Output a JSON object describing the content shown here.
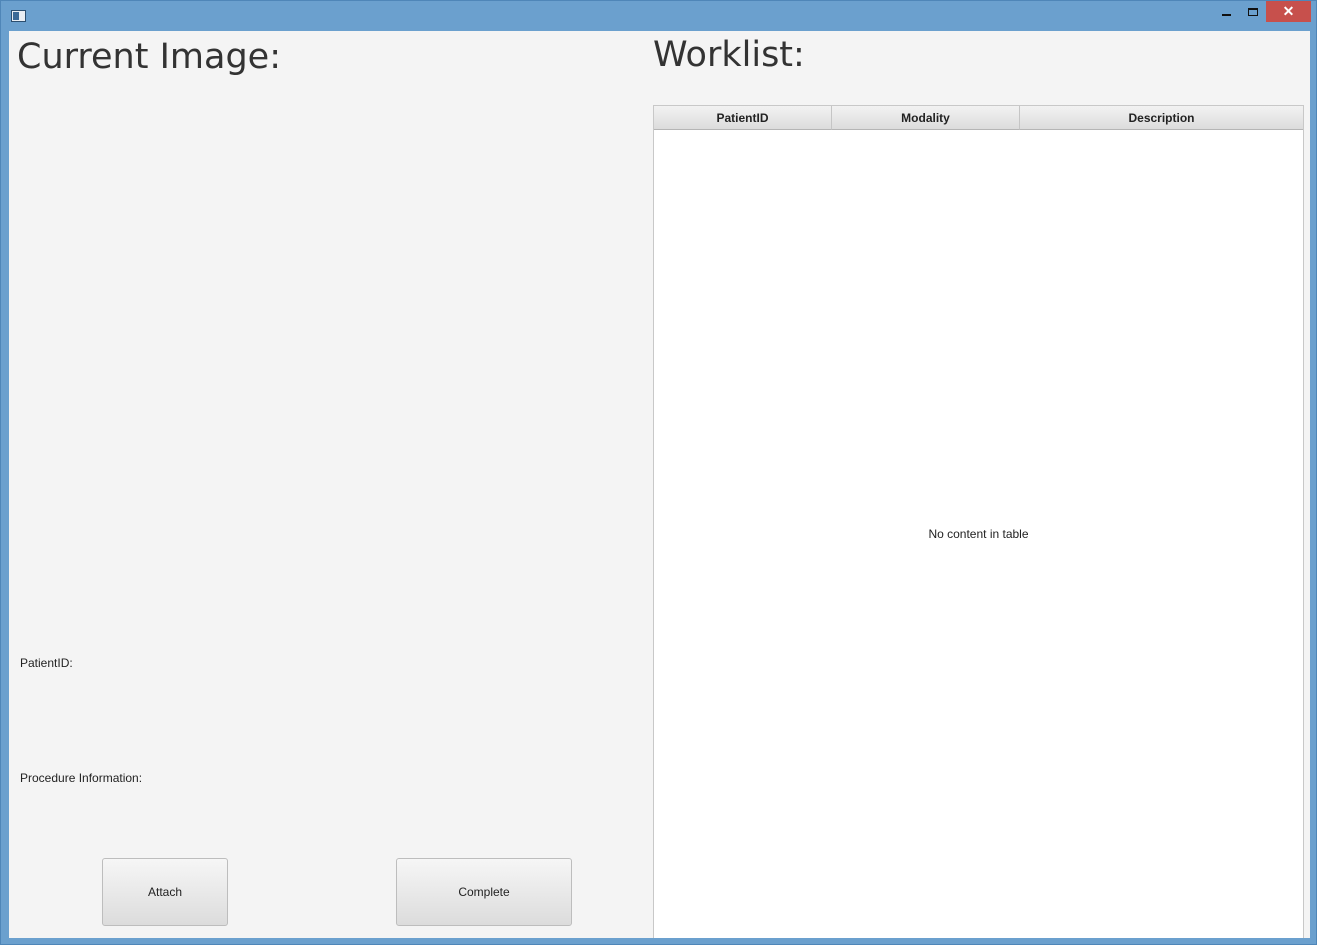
{
  "window": {
    "icon": "java-app-icon",
    "controls": {
      "minimize": "minimize-icon",
      "maximize": "maximize-icon",
      "close": "close-icon",
      "close_color": "#c7504c"
    }
  },
  "left_panel": {
    "title": "Current Image:",
    "patient_id_label": "PatientID:",
    "procedure_label": "Procedure Information:",
    "buttons": {
      "attach": "Attach",
      "complete": "Complete"
    }
  },
  "right_panel": {
    "title": "Worklist:",
    "table": {
      "columns": [
        "PatientID",
        "Modality",
        "Description"
      ],
      "rows": [],
      "placeholder": "No content in table"
    }
  },
  "colors": {
    "frame": "#6ba0ce",
    "background": "#f4f4f4"
  }
}
